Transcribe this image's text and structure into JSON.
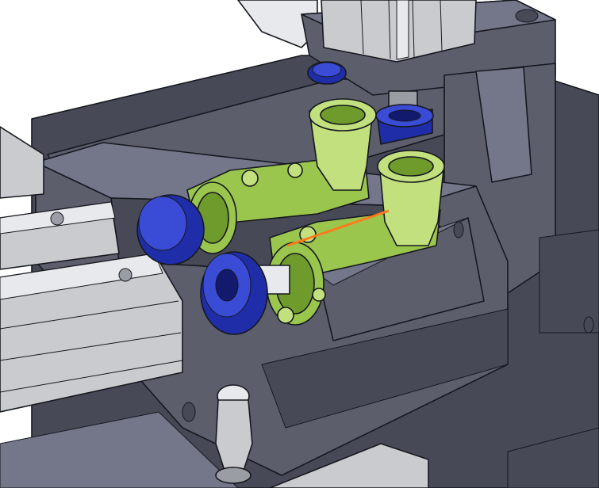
{
  "scene": {
    "background": "#ffffff",
    "colors": {
      "fixture_steel": "#5c5e6c",
      "workpiece_green": "#9ac64e",
      "roller_blue": "#1f2ea8",
      "cylinder_aluminum": "#c9cbcf",
      "marker_orange": "#ff7a1a"
    }
  }
}
